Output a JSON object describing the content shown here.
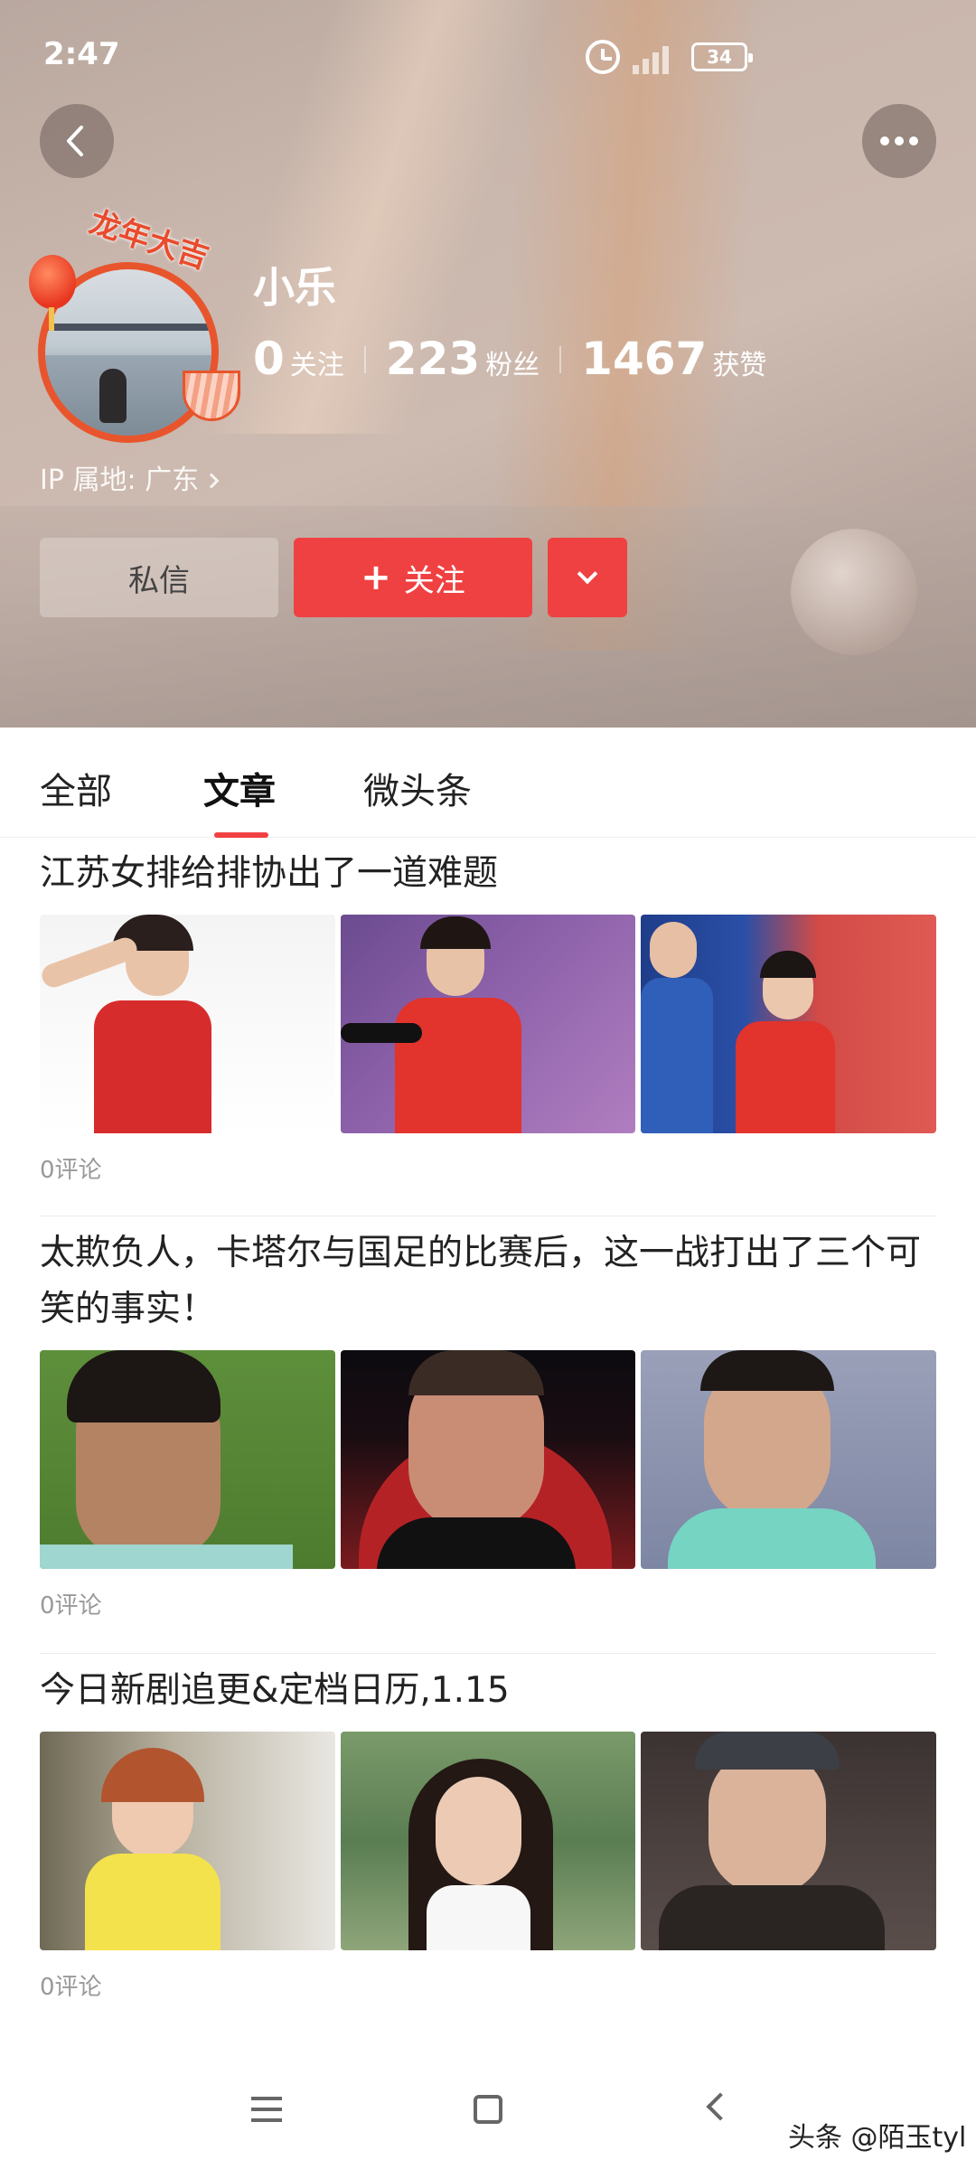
{
  "status_bar": {
    "time": "2:47",
    "battery": "34"
  },
  "profile": {
    "avatar_badge": "龙年大吉",
    "name": "小乐",
    "stats": [
      {
        "value": "0",
        "label": "关注"
      },
      {
        "value": "223",
        "label": "粉丝"
      },
      {
        "value": "1467",
        "label": "获赞"
      }
    ],
    "ip_location": "IP 属地: 广东"
  },
  "actions": {
    "message": "私信",
    "follow": "关注",
    "follow_plus": "+"
  },
  "tabs": [
    {
      "label": "全部",
      "active": false
    },
    {
      "label": "文章",
      "active": true
    },
    {
      "label": "微头条",
      "active": false
    }
  ],
  "articles": [
    {
      "title": "江苏女排给排协出了一道难题",
      "comments": "0评论"
    },
    {
      "title": "太欺负人，卡塔尔与国足的比赛后，这一战打出了三个可笑的事实！",
      "comments": "0评论"
    },
    {
      "title": "今日新剧追更&定档日历,1.15",
      "comments": "0评论"
    }
  ],
  "watermark": "头条 @陌玉tyl",
  "colors": {
    "accent": "#f04142",
    "header_bg": "#c4b2a8"
  }
}
